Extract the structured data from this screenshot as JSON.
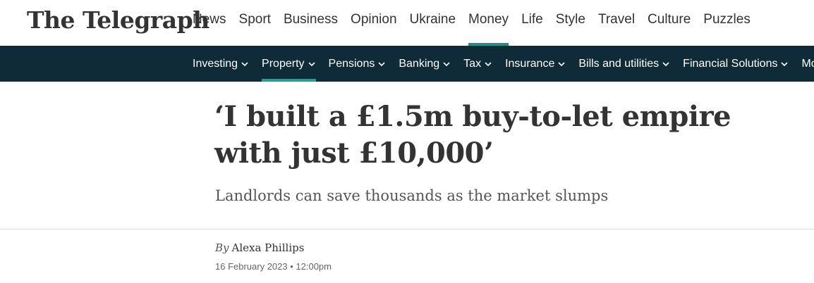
{
  "masthead": {
    "logo": "The Telegraph",
    "nav": [
      "News",
      "Sport",
      "Business",
      "Opinion",
      "Ukraine",
      "Money",
      "Life",
      "Style",
      "Travel",
      "Culture",
      "Puzzles"
    ],
    "active": "Money"
  },
  "subnav": {
    "items": [
      "Investing",
      "Property",
      "Pensions",
      "Banking",
      "Tax",
      "Insurance",
      "Bills and utilities",
      "Financial Solutions",
      "More"
    ],
    "active": "Property"
  },
  "article": {
    "headline": "‘I built a £1.5m buy-to-let empire with just £10,000’",
    "standfirst": "Landlords can save thousands as the market slumps",
    "byline_prefix": "By",
    "author": "Alexa Phillips",
    "date": "16 February 2023 • 12:00pm"
  },
  "colors": {
    "accent": "#2a8a88",
    "subnav_bg": "#0f2b38"
  }
}
